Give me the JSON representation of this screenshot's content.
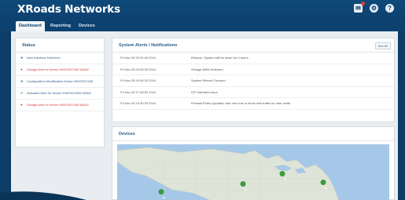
{
  "app": {
    "title": "XRoads Networks"
  },
  "header": {
    "icons": [
      "message-icon",
      "gear-icon",
      "help-icon"
    ]
  },
  "tabs": [
    {
      "label": "Dashboard",
      "active": true
    },
    {
      "label": "Reporting",
      "active": false
    },
    {
      "label": "Devices",
      "active": false
    }
  ],
  "status": {
    "title": "Status",
    "items": [
      {
        "type": "info",
        "icon": "arrow-right-icon",
        "text": "New Interface Detected -"
      },
      {
        "type": "alert",
        "icon": "alert-circle-icon",
        "text": "Outage Alert for device 00997812345 WAN2"
      },
      {
        "type": "info",
        "icon": "arrow-right-icon",
        "text": "Configuration Modification Notice 00997812345"
      },
      {
        "type": "ok",
        "icon": "check-icon",
        "text": "Activated Alert for device 00997812345 WAN2"
      },
      {
        "type": "alert",
        "icon": "alert-circle-icon",
        "text": "Outage Alert for device 00997812345 WAN2"
      }
    ]
  },
  "alerts": {
    "title": "System Alerts / Notifications",
    "see_all": "See All",
    "rows": [
      {
        "when": "Fri Nov 28 20:22:49 2014",
        "msg": "Restore: System will be down for 5 hours"
      },
      {
        "when": "Fri Nov 28 20:06:33 2014",
        "msg": "Outage WAN Detected"
      },
      {
        "when": "Fri Nov 28 19:34:29 2014",
        "msg": "System Reboot Occured"
      },
      {
        "when": "Fri Nov 28 17:36:53 2014",
        "msg": "ICP Interface issue"
      },
      {
        "when": "Fri Nov 28 16:40:33 2014",
        "msg": "Firewall Rules Updated: Add new rule to block web traffic for user smith"
      }
    ]
  },
  "devices": {
    "title": "Devices"
  },
  "colors": {
    "header_bg": "#0d4170",
    "content_bg": "#e9edf1",
    "alert_red": "#d23a3a",
    "link_blue": "#2f5f8d",
    "map_water": "#a6c8e8",
    "map_land": "#dfe4d8",
    "pin_green": "#3f9a3f"
  }
}
